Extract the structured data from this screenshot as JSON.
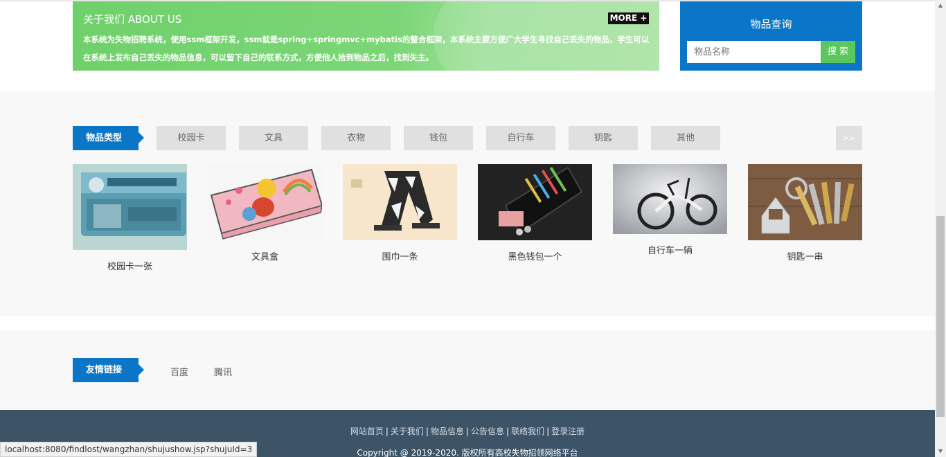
{
  "about": {
    "title": "关于我们 ABOUT US",
    "more": "MORE +",
    "description": "本系统为失物招聘系统，使用ssm框架开发，ssm就是spring+springmvc+mybatis的整合框架，本系统主要方便广大学生寻找自己丢失的物品，学生可以在系统上发布自己丢失的物品信息，可以留下自己的联系方式，方便他人拾到物品之后，找到失主。"
  },
  "search": {
    "title": "物品查询",
    "placeholder": "物品名称",
    "button": "搜 索"
  },
  "categories": {
    "label": "物品类型",
    "tabs": [
      "校园卡",
      "文具",
      "衣物",
      "钱包",
      "自行车",
      "钥匙",
      "其他"
    ],
    "next": ">>"
  },
  "items": [
    {
      "caption": "校园卡一张"
    },
    {
      "caption": "文具盒"
    },
    {
      "caption": "围巾一条"
    },
    {
      "caption": "黑色钱包一个"
    },
    {
      "caption": "自行车一辆"
    },
    {
      "caption": "钥匙一串"
    }
  ],
  "links": {
    "label": "友情链接",
    "items": [
      "百度",
      "腾讯"
    ]
  },
  "footer": {
    "nav": [
      "网站首页",
      "关于我们",
      "物品信息",
      "公告信息",
      "联络我们",
      "登录注册"
    ],
    "copyright": "Copyright @ 2019-2020. 版权所有高校失物招领网络平台"
  },
  "status_url": "localhost:8080/findlost/wangzhan/shujushow.jsp?shujuId=3",
  "colors": {
    "accent": "#0b76c8",
    "green": "#6fd06a",
    "footer": "#3d5467"
  }
}
